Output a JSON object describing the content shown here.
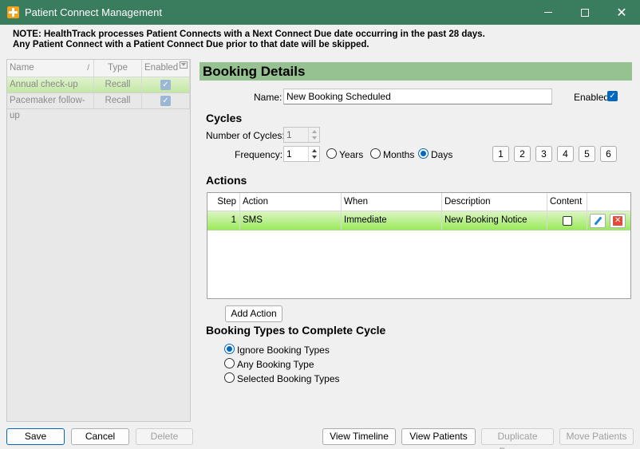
{
  "window": {
    "title": "Patient Connect Management",
    "minimize": "",
    "maximize": "",
    "close": "✕"
  },
  "note": {
    "line1": "NOTE: HealthTrack processes Patient Connects with a Next Connect Due date occurring in the past 28 days.",
    "line2": "Any Patient Connect with a Patient Connect Due prior to that date will be skipped."
  },
  "programs": {
    "headers": {
      "name": "Name",
      "sort": "/",
      "type": "Type",
      "enabled": "Enabled"
    },
    "rows": [
      {
        "name": "Annual check-up",
        "type": "Recall",
        "enabled": "✓"
      },
      {
        "name": "Pacemaker follow-up",
        "type": "Recall",
        "enabled": "✓"
      }
    ]
  },
  "left_buttons": {
    "save": "Save",
    "cancel": "Cancel",
    "delete": "Delete"
  },
  "booking": {
    "header": "Booking Details",
    "name_label": "Name:",
    "name_value": "New Booking Scheduled",
    "enabled_label": "Enabled",
    "enabled_check": "✓"
  },
  "cycles": {
    "title": "Cycles",
    "num_label": "Number of Cycles:",
    "num_value": "1",
    "freq_label": "Frequency:",
    "freq_value": "1",
    "units": {
      "years": "Years",
      "months": "Months",
      "days": "Days"
    },
    "presets": [
      "1",
      "2",
      "3",
      "4",
      "5",
      "6"
    ]
  },
  "actions": {
    "title": "Actions",
    "headers": {
      "step": "Step",
      "action": "Action",
      "when": "When",
      "description": "Description",
      "content": "Content"
    },
    "rows": [
      {
        "step": "1",
        "action": "SMS",
        "when": "Immediate",
        "description": "New Booking Notice"
      }
    ],
    "add_button": "Add Action"
  },
  "booking_types": {
    "title": "Booking Types to Complete Cycle",
    "options": [
      "Ignore Booking Types",
      "Any Booking Type",
      "Selected Booking Types"
    ]
  },
  "bottom_buttons": {
    "view_timeline": "View Timeline",
    "view_patients": "View Patients",
    "duplicate_program": "Duplicate Program",
    "move_patients": "Move Patients"
  }
}
